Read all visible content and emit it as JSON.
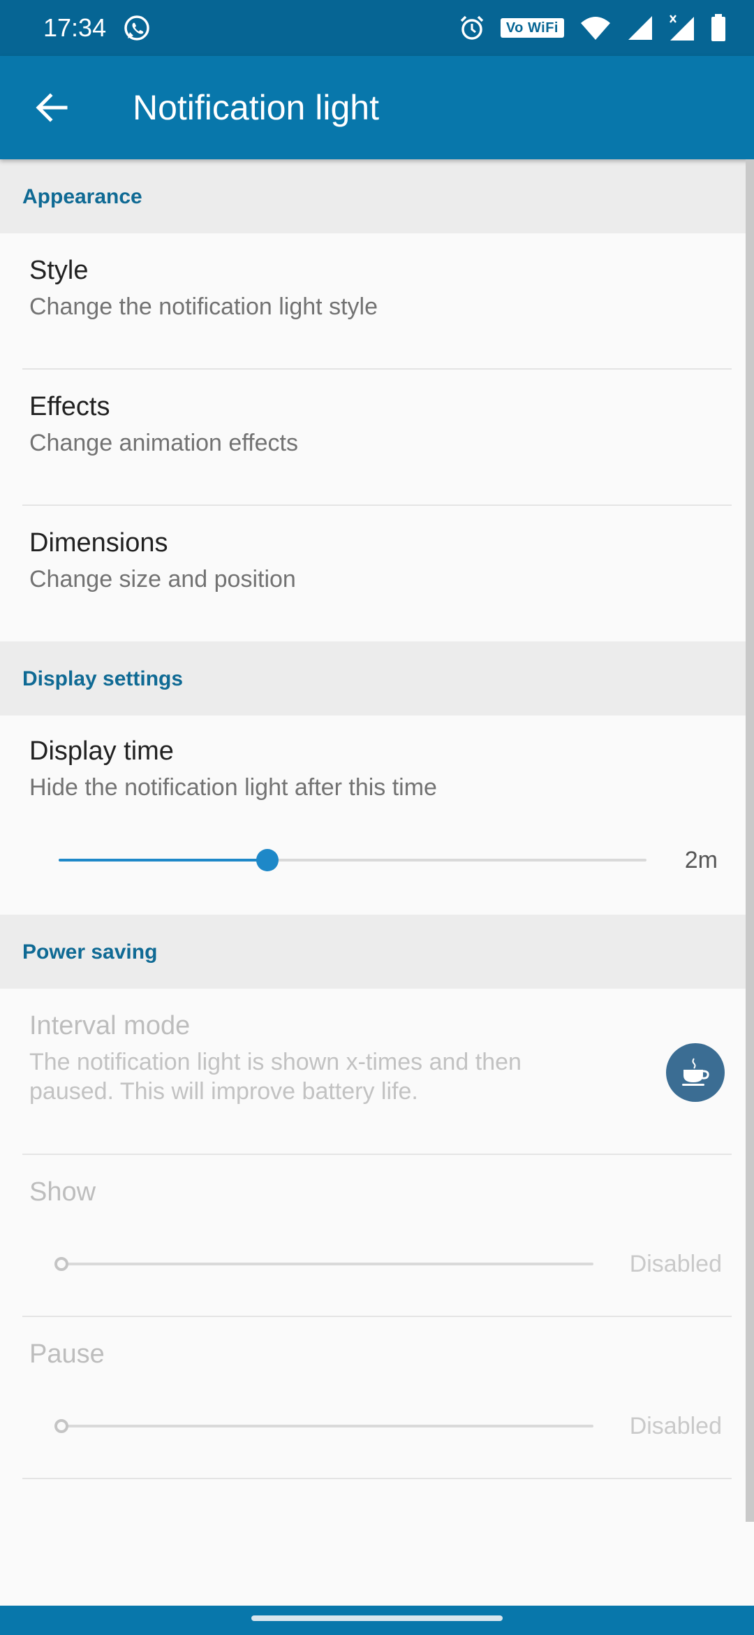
{
  "status_bar": {
    "time": "17:34",
    "vowifi_label": "Vo WiFi",
    "icons": [
      "whatsapp-icon",
      "alarm-icon",
      "vowifi-icon",
      "wifi-icon",
      "signal-icon",
      "signal-x-icon",
      "battery-icon"
    ]
  },
  "app_bar": {
    "title": "Notification light",
    "back_icon": "arrow-left-icon"
  },
  "sections": {
    "appearance": {
      "header": "Appearance",
      "items": [
        {
          "title": "Style",
          "summary": "Change the notification light style"
        },
        {
          "title": "Effects",
          "summary": "Change animation effects"
        },
        {
          "title": "Dimensions",
          "summary": "Change size and position"
        }
      ]
    },
    "display_settings": {
      "header": "Display settings",
      "display_time": {
        "title": "Display time",
        "summary": "Hide the notification light after this time",
        "value": "2m",
        "slider_fraction": 0.355
      }
    },
    "power_saving": {
      "header": "Power saving",
      "interval_mode": {
        "title": "Interval mode",
        "summary_line1": "The notification light is shown x-times and then",
        "summary_line2": "paused. This will improve battery life.",
        "badge_icon": "coffee-cup-icon"
      },
      "show": {
        "title": "Show",
        "value": "Disabled",
        "slider_fraction": 0
      },
      "pause": {
        "title": "Pause",
        "value": "Disabled",
        "slider_fraction": 0
      }
    }
  },
  "colors": {
    "status_bar": "#066594",
    "app_bar": "#0877ab",
    "accent": "#1e88c8",
    "section_header_text": "#0f6a94",
    "section_header_bg": "#ececec",
    "badge": "#3b6d93"
  }
}
